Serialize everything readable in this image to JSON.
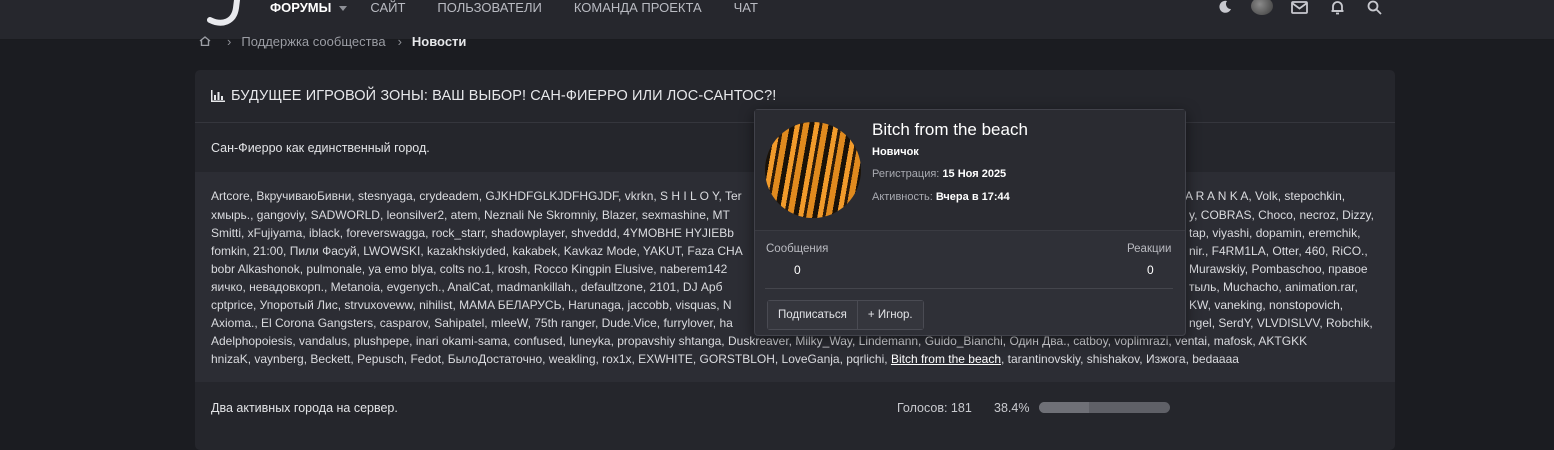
{
  "nav": {
    "items": [
      "ФОРУМЫ",
      "САЙТ",
      "ПОЛЬЗОВАТЕЛИ",
      "КОМАНДА ПРОЕКТА",
      "ЧАТ"
    ]
  },
  "breadcrumb": {
    "items": [
      "Поддержка сообщества",
      "Новости"
    ]
  },
  "poll": {
    "title": "БУДУЩЕЕ ИГРОВОЙ ЗОНЫ: ВАШ ВЫБОР! САН-ФИЕРРО ИЛИ ЛОС-САНТОС?!",
    "option1_label": "Сан-Фиерро как единственный город.",
    "voter_lines": [
      "Artcore, ВкручиваюБивни, stesnyaga, crydeadem, GJKHDFGLKJDFHGJDF, vkrkn, S H I L O Y, Ter",
      "хмырь., gangoviy, SADWORLD, leonsilver2, atem, Neznali Ne Skromniy, Blazer, sexmashine, MT",
      "Smitti, xFujiyama, iblack, foreverswagga, rock_starr, shadowplayer, shveddd, 4YMOBHE HYJIEBb",
      "fomkin, 21:00, Пили Фасуй, LWOWSKI, kazakhskiyded, kakabek, Kavkaz Mode, YAKUT, Faza CHA",
      "bobr Alkashonok, pulmonale, ya emo blya, colts no.1, krosh, Rocco Kingpin Elusive, naberem142",
      "яичко, невадовкорп., Metanoia, evgenych., AnalCat, madmankillah., defaultzone, 2101, DJ Арб",
      "cptprice, Упоротый Лис, strvuxoveww, nihilist, MAMA БЕЛАРУСЬ, Harunaga, jaccobb, visquas, N",
      "Axioma., El Corona Gangsters, casparov, Sahipatel, mleeW, 75th ranger, Dude.Vice, furrylover, ha",
      "Adelphopoiesis, vandalus, plushpepe, inari okami-sama, confused, luneyka, propavshiy shtanga, Duskreaver, Milky_Way, Lindemann, Guido_Bianchi, Один Два., catboy, voplimrazi, ventai, mafosk, AKTGKK",
      "hnizaK, vaynberg, Beckett, Pepusch, Fedot, БылоДостаточно, weakling, rox1x, EXWHITE, GORSTBLOH, LoveGanja, pqrlichi, "
    ],
    "voter_lines_right": [
      "A R A N K A, Volk, stepochkin,",
      "y, COBRAS, Choco, necroz, Dizzy,",
      "tap, viyashi, dopamin, eremchik,",
      "nir., F4RM1LA, Otter, 460, RiCO.,",
      "Murawskiy, Pombaschoo, правое",
      "тыль, Muchacho, animation.rar,",
      "KW, vaneking, nonstopovich,",
      "ngel, SerdY, VLVDISLVV, Robchik,"
    ],
    "highlighted_voter": "Bitch from the beach",
    "last_line_tail": ", tarantinovskiy, shishakov, Изжога, bedaaaa",
    "option2_label": "Два активных города на сервер.",
    "option2_votes": "Голосов: 181",
    "option2_percent": "38.4%",
    "option2_fraction": 0.384
  },
  "member_tooltip": {
    "name": "Bitch from the beach",
    "rank": "Новичок",
    "registered_label": "Регистрация:",
    "registered_value": "15 Ноя 2025",
    "activity_label": "Активность:",
    "activity_value": "Вчера в 17:44",
    "messages_label": "Сообщения",
    "messages_value": "0",
    "reactions_label": "Реакции",
    "reactions_value": "0",
    "follow_button": "Подписаться",
    "ignore_button": "+ Игнор."
  }
}
